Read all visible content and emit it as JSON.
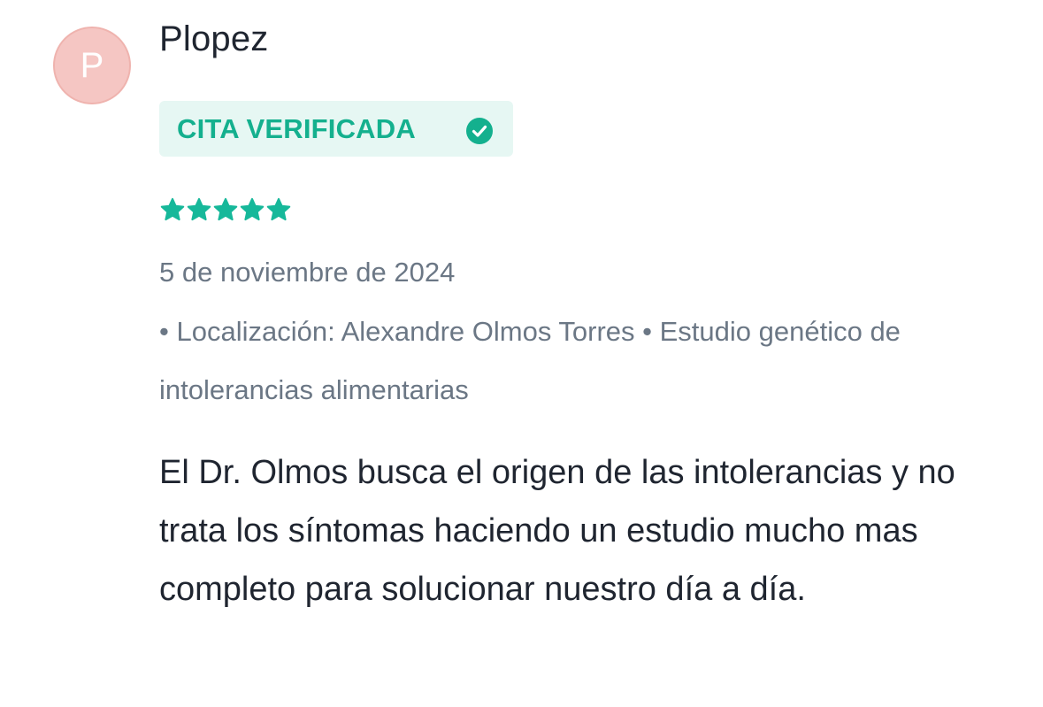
{
  "review": {
    "avatar_initial": "P",
    "username": "Plopez",
    "badge_label": "CITA VERIFICADA",
    "badge_icon": "check-circle-icon",
    "rating": 5,
    "rating_max": 5,
    "date": "5 de noviembre de 2024",
    "meta": "• Localización: Alexandre Olmos Torres • Estudio genético de intolerancias alimentarias",
    "text": "El Dr. Olmos busca el origen de las intolerancias y no trata los síntomas haciendo un estudio mucho mas completo para solucionar nuestro día a día."
  },
  "colors": {
    "accent": "#14b08e",
    "star": "#16b89a",
    "badge_bg": "#e6f7f3",
    "avatar_bg": "#f5c6c3",
    "muted_text": "#6b7785",
    "primary_text": "#1f2530"
  }
}
